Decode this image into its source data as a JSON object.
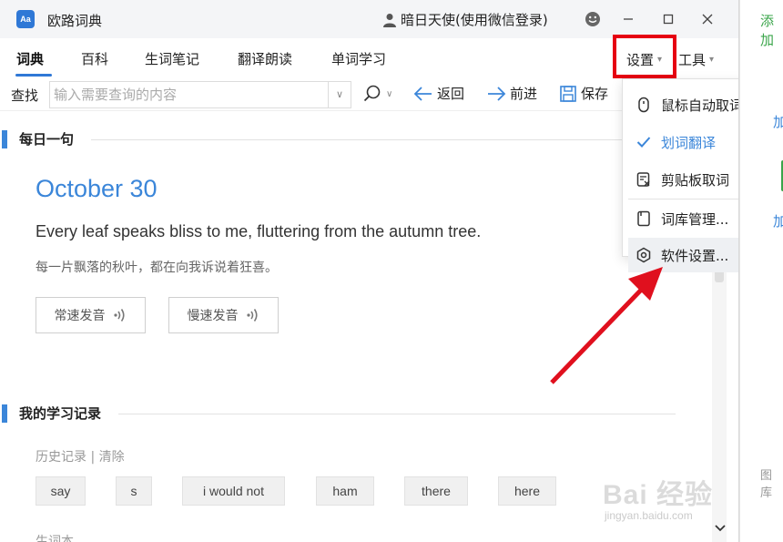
{
  "window": {
    "app_title": "欧路词典",
    "logo_text": "Aa",
    "user_label": "暗日天使(使用微信登录)",
    "icons": [
      "user-icon",
      "smiley-icon",
      "minimize-icon",
      "maximize-icon",
      "close-icon"
    ]
  },
  "tabs": [
    {
      "label": "词典",
      "active": true
    },
    {
      "label": "百科",
      "active": false
    },
    {
      "label": "生词笔记",
      "active": false
    },
    {
      "label": "翻译朗读",
      "active": false
    },
    {
      "label": "单词学习",
      "active": false
    }
  ],
  "menus": {
    "settings": "设置",
    "tools": "工具"
  },
  "search": {
    "label": "查找",
    "placeholder": "输入需要查询的内容",
    "value": "",
    "back": "返回",
    "forward": "前进",
    "save": "保存"
  },
  "daily": {
    "section_title": "每日一句",
    "date": "October 30",
    "sentence_en": "Every leaf speaks bliss to me, fluttering from the autumn tree.",
    "sentence_zh": "每一片飘落的秋叶，都在向我诉说着狂喜。",
    "normal_speed": "常速发音",
    "slow_speed": "慢速发音"
  },
  "study": {
    "section_title": "我的学习记录",
    "history_label": "历史记录 | 清除",
    "history": [
      "say",
      "s",
      "i would not",
      "ham",
      "there",
      "here"
    ],
    "notebook_label": "生词本"
  },
  "settings_menu": {
    "items": [
      {
        "label": "鼠标自动取词",
        "icon": "mouse-icon",
        "checked": false
      },
      {
        "label": "划词翻译",
        "icon": "check-icon",
        "checked": true
      },
      {
        "label": "剪贴板取词",
        "icon": "clipboard-icon",
        "checked": false
      },
      {
        "label": "词库管理...",
        "icon": "library-icon",
        "checked": false
      },
      {
        "label": "软件设置...",
        "icon": "gear-icon",
        "checked": false,
        "highlighted": true
      }
    ]
  },
  "side_panel": {
    "add_label": "添加",
    "frag1": "加",
    "frag2": "加",
    "lib_label": "图库"
  },
  "watermark": {
    "text": "Bai 经验",
    "url": "jingyan.baidu.com"
  },
  "colors": {
    "accent": "#3b86d9",
    "highlight_box": "#e60012",
    "arrow": "#e0101e",
    "green": "#3aa54a"
  }
}
